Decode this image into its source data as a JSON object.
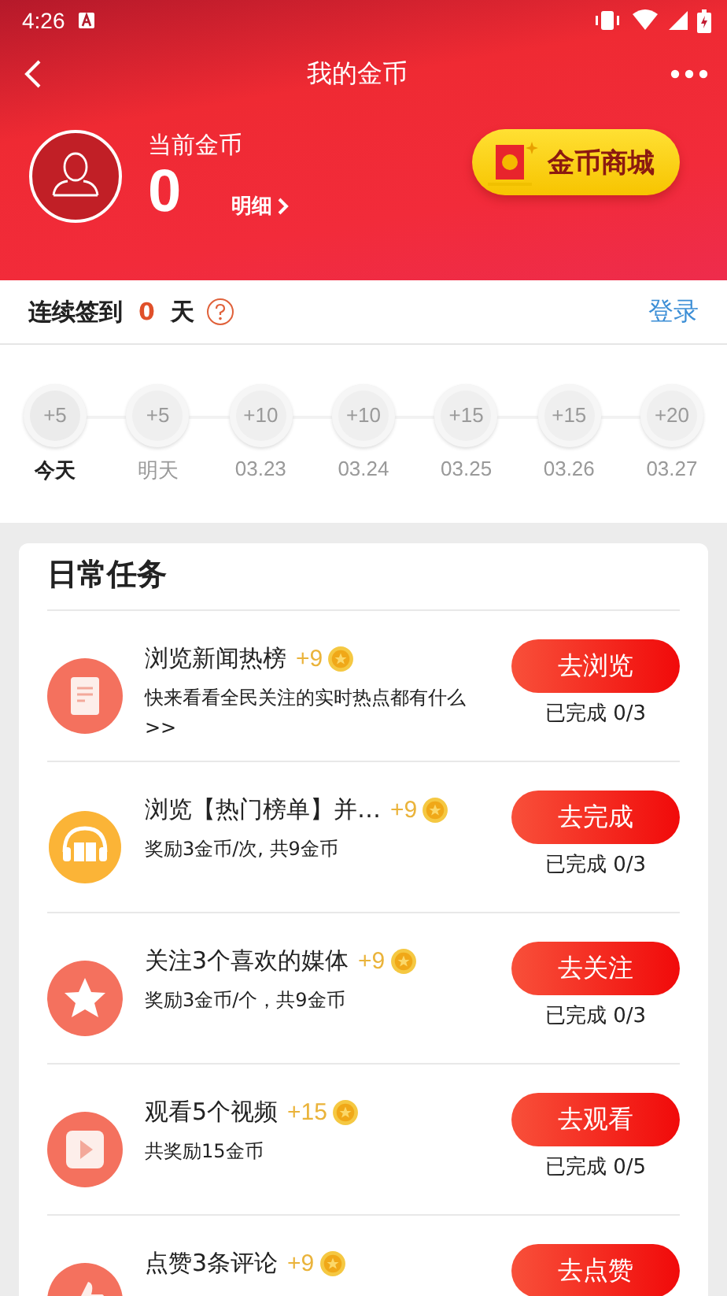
{
  "status_bar": {
    "time": "4:26"
  },
  "header": {
    "title": "我的金币"
  },
  "coins": {
    "label": "当前金币",
    "value": "0",
    "detail_link": "明细",
    "shop_button": "金币商城"
  },
  "signin": {
    "prefix": "连续签到",
    "days": "0",
    "suffix": "天",
    "login_link": "登录"
  },
  "days": [
    {
      "reward": "+5",
      "label": "今天",
      "current": true
    },
    {
      "reward": "+5",
      "label": "明天",
      "current": false
    },
    {
      "reward": "+10",
      "label": "03.23",
      "current": false
    },
    {
      "reward": "+10",
      "label": "03.24",
      "current": false
    },
    {
      "reward": "+15",
      "label": "03.25",
      "current": false
    },
    {
      "reward": "+15",
      "label": "03.26",
      "current": false
    },
    {
      "reward": "+20",
      "label": "03.27",
      "current": false
    }
  ],
  "tasks_title": "日常任务",
  "tasks": [
    {
      "kind": "document",
      "title": "浏览新闻热榜",
      "reward": "+9",
      "description": "快来看看全民关注的实时热点都有什么>>",
      "button": "去浏览",
      "progress": "已完成 0/3"
    },
    {
      "kind": "headphones",
      "title": "浏览【热门榜单】并…",
      "reward": "+9",
      "description": "奖励3金币/次, 共9金币",
      "button": "去完成",
      "progress": "已完成 0/3"
    },
    {
      "kind": "star",
      "title": "关注3个喜欢的媒体",
      "reward": "+9",
      "description": "奖励3金币/个，共9金币",
      "button": "去关注",
      "progress": "已完成 0/3"
    },
    {
      "kind": "play",
      "title": "观看5个视频",
      "reward": "+15",
      "description": "共奖励15金币",
      "button": "去观看",
      "progress": "已完成 0/5"
    },
    {
      "kind": "thumb",
      "title": "点赞3条评论",
      "reward": "+9",
      "button": "去点赞"
    }
  ]
}
